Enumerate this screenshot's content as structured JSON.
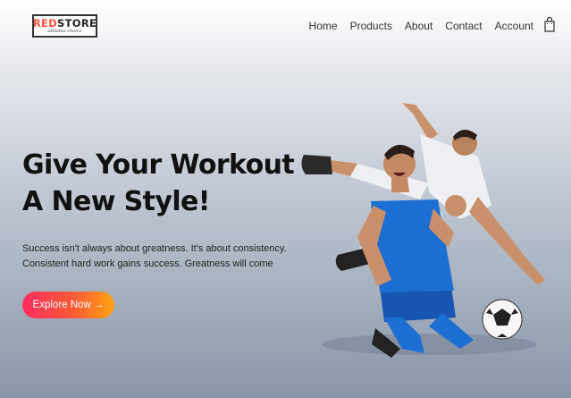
{
  "header": {
    "logo": {
      "red": "RED",
      "dark": "STORE",
      "tagline": "athletes choice"
    },
    "menu": [
      "Home",
      "Products",
      "About",
      "Contact",
      "Account"
    ],
    "cart_icon": "shopping-bag-icon"
  },
  "hero": {
    "title_line1": "Give Your Workout",
    "title_line2": "A New Style!",
    "description_line1": "Success isn't always about greatness. It's about consistency.",
    "description_line2": "Consistent hard work gains success. Greatness will come",
    "button_label": "Explore Now →",
    "image_icon": "football-players-image"
  },
  "colors": {
    "accent": "#ff523b",
    "button_start": "#ff2d5f",
    "button_end": "#ffa313",
    "jersey_blue": "#1c6fd1"
  }
}
